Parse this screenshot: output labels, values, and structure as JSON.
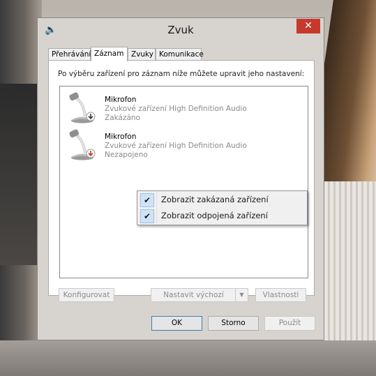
{
  "window": {
    "title": "Zvuk",
    "close_glyph": "✕"
  },
  "tabs": [
    {
      "label": "Přehrávání"
    },
    {
      "label": "Záznam"
    },
    {
      "label": "Zvuky"
    },
    {
      "label": "Komunikace"
    }
  ],
  "panel": {
    "hint": "Po výběru zařízení pro záznam níže můžete upravit jeho nastavení:"
  },
  "devices": [
    {
      "name": "Mikrofon",
      "description": "Zvukové zařízení High Definition Audio",
      "status": "Zakázáno",
      "status_icon": "down-arrow-icon",
      "badge_color": "#3a3a3a"
    },
    {
      "name": "Mikrofon",
      "description": "Zvukové zařízení High Definition Audio",
      "status": "Nezapojeno",
      "status_icon": "down-arrow-icon",
      "badge_color": "#c0392b"
    }
  ],
  "buttons": {
    "configure": "Konfigurovat",
    "set_default": "Nastavit výchozí",
    "properties": "Vlastnosti",
    "ok": "OK",
    "cancel": "Storno",
    "apply": "Použít"
  },
  "context_menu": {
    "items": [
      {
        "label": "Zobrazit zakázaná zařízení",
        "checked": true
      },
      {
        "label": "Zobrazit odpojená zařízení",
        "checked": true
      }
    ],
    "check_glyph": "✔"
  },
  "colors": {
    "accent": "#c7382d",
    "menu_highlight": "#cfe3f7"
  }
}
